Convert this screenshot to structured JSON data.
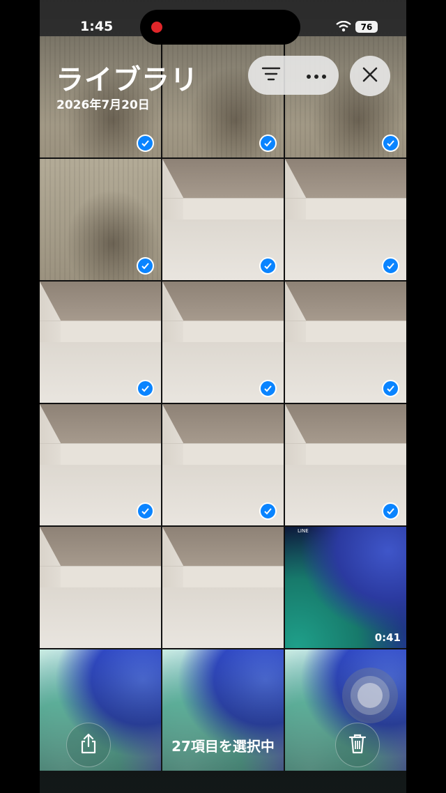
{
  "status_bar": {
    "time": "1:45",
    "battery": "76"
  },
  "header": {
    "title": "ライブラリ",
    "date": "2026年7月20日"
  },
  "toolbar": {
    "sort_icon": "sort-icon",
    "more_icon": "more-icon",
    "close_icon": "close-icon"
  },
  "grid": {
    "video_duration": "0:41",
    "line_app_label": "LINE"
  },
  "bottom_bar": {
    "selection_label": "27項目を選択中",
    "share_icon": "share-icon",
    "trash_icon": "trash-icon"
  },
  "colors": {
    "accent": "#0a84ff",
    "record": "#e0262a"
  }
}
